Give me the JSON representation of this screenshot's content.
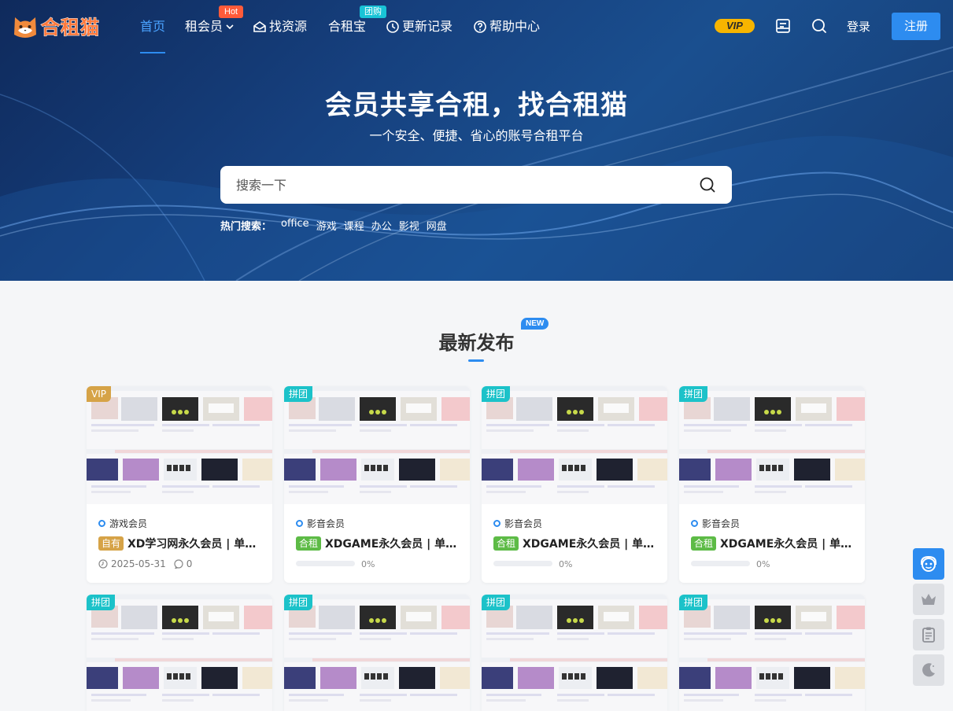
{
  "nav": {
    "logo_text": "合租猫",
    "items": [
      {
        "label": "首页",
        "active": true
      },
      {
        "label": "租会员",
        "dropdown": true,
        "badge": "Hot"
      },
      {
        "label": "找资源",
        "icon": "mail-open-icon"
      },
      {
        "label": "合租宝",
        "badge": "团购"
      },
      {
        "label": "更新记录",
        "icon": "clock-icon"
      },
      {
        "label": "帮助中心",
        "icon": "question-circle-icon"
      }
    ],
    "vip_label": "VIP",
    "login_label": "登录",
    "register_label": "注册"
  },
  "hero": {
    "title": "会员共享合租，找合租猫",
    "subtitle": "一个安全、便捷、省心的账号合租平台",
    "search_placeholder": "搜索一下",
    "hot_label": "热门搜索：",
    "hot_terms": [
      "office",
      "游戏",
      "课程",
      "办公",
      "影视",
      "网盘"
    ]
  },
  "section": {
    "title": "最新发布",
    "badge": "NEW"
  },
  "cards": [
    {
      "tag": "VIP",
      "tag_type": "vip",
      "category": "游戏会员",
      "pill": "自有",
      "pill_type": "own",
      "title": "XD学习网永久会员 | 单…",
      "date": "2025-05-31",
      "comments": "0"
    },
    {
      "tag": "拼团",
      "tag_type": "group",
      "category": "影音会员",
      "pill": "合租",
      "pill_type": "group",
      "title": "XDGAME永久会员 | 单…",
      "progress": 0,
      "progress_label": "0%"
    },
    {
      "tag": "拼团",
      "tag_type": "group",
      "category": "影音会员",
      "pill": "合租",
      "pill_type": "group",
      "title": "XDGAME永久会员 | 单…",
      "progress": 0,
      "progress_label": "0%"
    },
    {
      "tag": "拼团",
      "tag_type": "group",
      "category": "影音会员",
      "pill": "合租",
      "pill_type": "group",
      "title": "XDGAME永久会员 | 单…",
      "progress": 0,
      "progress_label": "0%"
    }
  ],
  "cards_row2": [
    {
      "tag": "拼团"
    },
    {
      "tag": "拼团"
    },
    {
      "tag": "拼团"
    },
    {
      "tag": "拼团"
    }
  ],
  "float_buttons": [
    "support-icon",
    "crown-icon",
    "clipboard-icon",
    "moon-icon"
  ]
}
